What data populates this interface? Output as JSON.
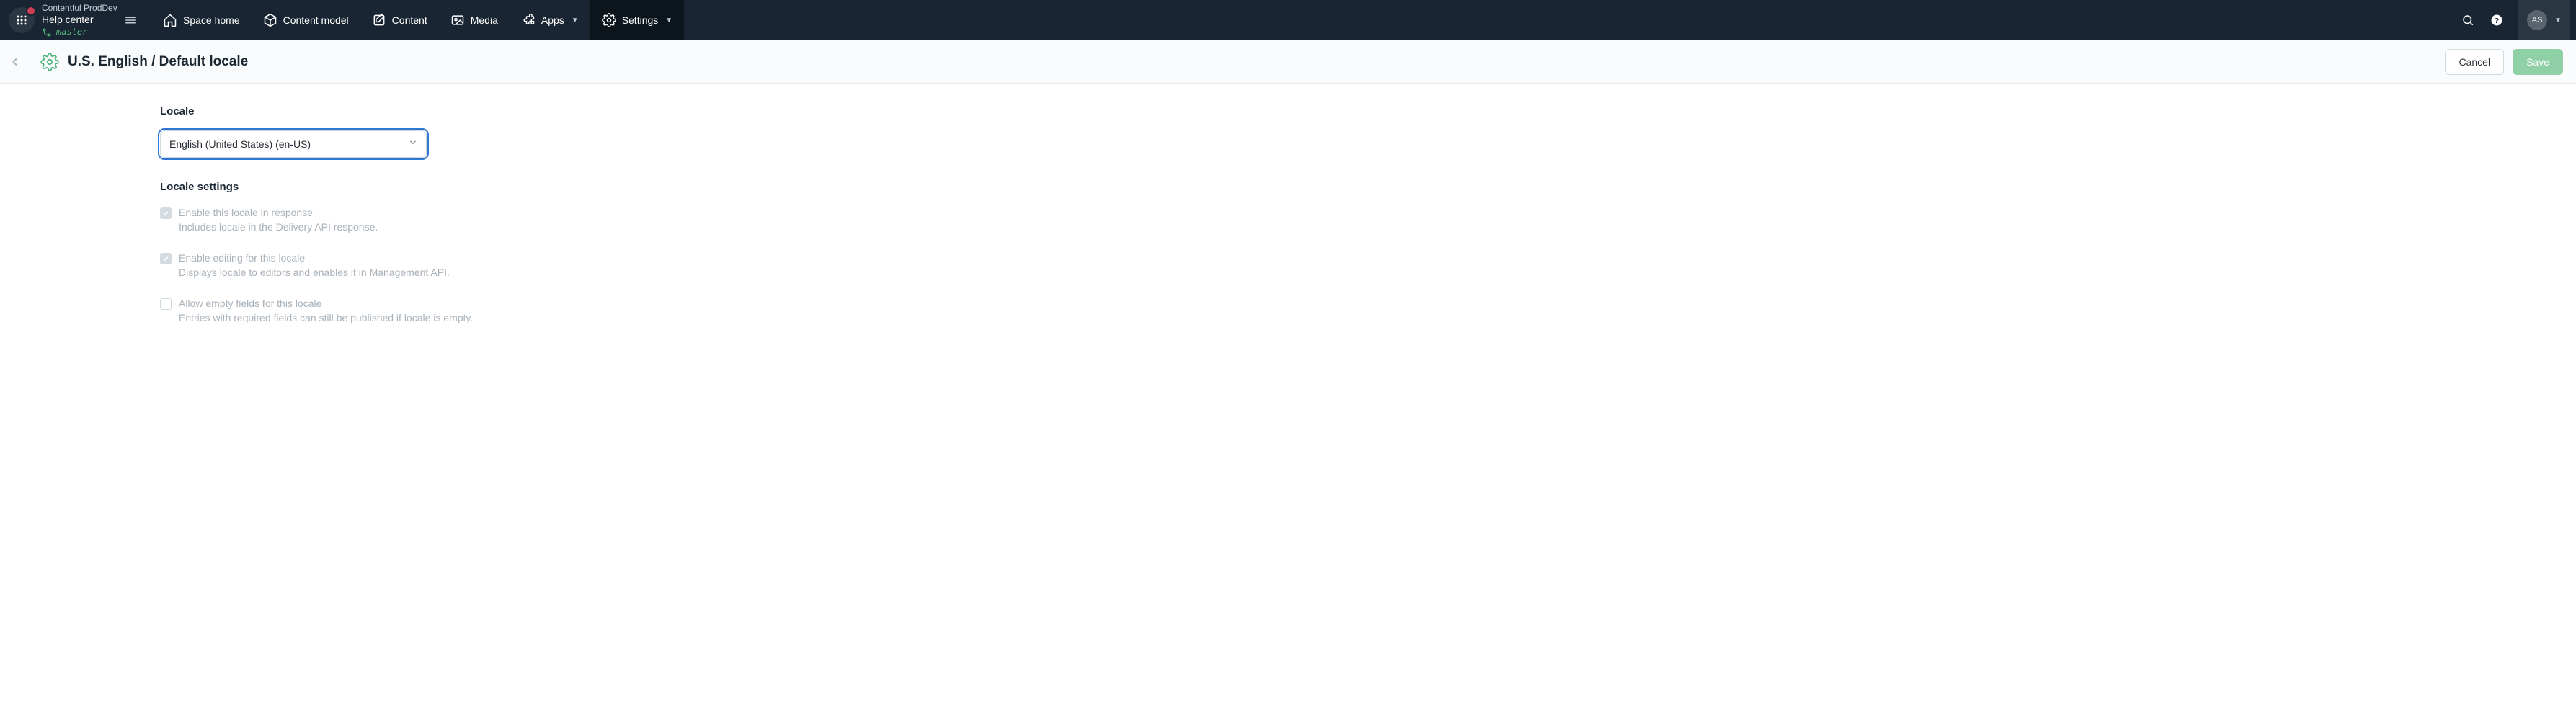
{
  "topbar": {
    "org": "Contentful ProdDev",
    "space": "Help center",
    "branch": "master",
    "nav": [
      {
        "label": "Space home",
        "icon": "home-icon"
      },
      {
        "label": "Content model",
        "icon": "model-icon"
      },
      {
        "label": "Content",
        "icon": "content-icon"
      },
      {
        "label": "Media",
        "icon": "media-icon"
      },
      {
        "label": "Apps",
        "icon": "apps-icon",
        "caret": true
      },
      {
        "label": "Settings",
        "icon": "settings-icon",
        "caret": true,
        "active": true
      }
    ],
    "avatar_initials": "AS"
  },
  "header": {
    "title": "U.S. English / Default locale",
    "cancel_label": "Cancel",
    "save_label": "Save"
  },
  "form": {
    "locale_label": "Locale",
    "locale_value": "English (United States) (en-US)",
    "settings_label": "Locale settings",
    "settings": [
      {
        "title": "Enable this locale in response",
        "desc": "Includes locale in the Delivery API response.",
        "checked": true
      },
      {
        "title": "Enable editing for this locale",
        "desc": "Displays locale to editors and enables it in Management API.",
        "checked": true
      },
      {
        "title": "Allow empty fields for this locale",
        "desc": "Entries with required fields can still be published if locale is empty.",
        "checked": false
      }
    ]
  }
}
